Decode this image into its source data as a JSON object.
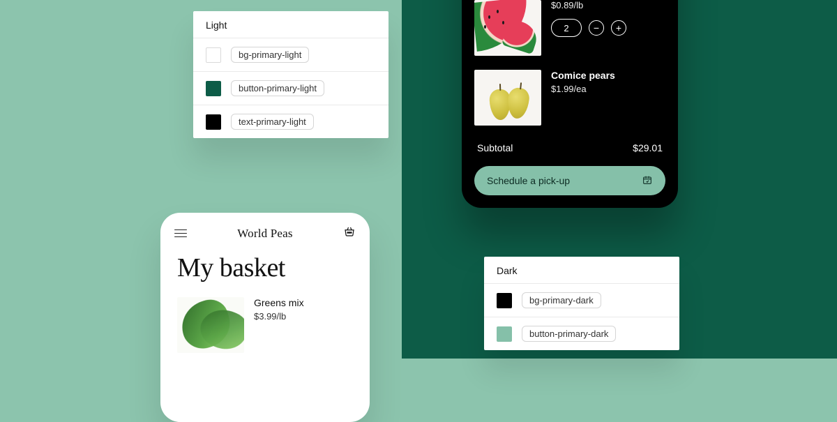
{
  "tokens": {
    "light": {
      "title": "Light",
      "items": [
        {
          "name": "bg-primary-light",
          "color": "#ffffff",
          "outline": true
        },
        {
          "name": "button-primary-light",
          "color": "#0d5c47",
          "outline": false
        },
        {
          "name": "text-primary-light",
          "color": "#000000",
          "outline": false
        }
      ]
    },
    "dark": {
      "title": "Dark",
      "items": [
        {
          "name": "bg-primary-dark",
          "color": "#000000",
          "outline": false
        },
        {
          "name": "button-primary-dark",
          "color": "#85c0a9",
          "outline": false
        }
      ]
    }
  },
  "phone_light": {
    "brand": "World Peas",
    "headline": "My basket",
    "item": {
      "name": "Greens mix",
      "price": "$3.99/lb"
    }
  },
  "phone_dark": {
    "items": [
      {
        "name_hidden": true,
        "price": "$0.89/lb",
        "qty": "2"
      },
      {
        "name": "Comice pears",
        "price": "$1.99/ea"
      }
    ],
    "subtotal_label": "Subtotal",
    "subtotal_value": "$29.01",
    "cta_label": "Schedule a pick-up"
  }
}
